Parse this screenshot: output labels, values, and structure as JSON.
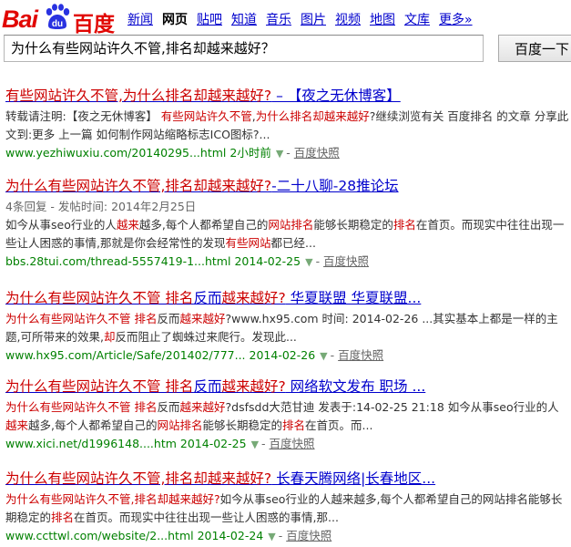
{
  "logo": {
    "part1": "Bai",
    "part2": "du",
    "part3": "百度"
  },
  "nav": [
    "新闻",
    "网页",
    "贴吧",
    "知道",
    "音乐",
    "图片",
    "视频",
    "地图",
    "文库",
    "更多»"
  ],
  "search": {
    "value": "为什么有些网站许久不管,排名却越来越好？",
    "button": "百度一下"
  },
  "results": [
    {
      "title": [
        "有些网站许久不管,为什么排名却越来越好?",
        " – 【夜之无休博客】"
      ],
      "abstract": [
        {
          "t": "转载请注明:【夜之无休博客】 "
        },
        {
          "t": "有些网站许久不管",
          "h": true
        },
        {
          "t": ","
        },
        {
          "t": "为什么排名却越来越好",
          "h": true
        },
        {
          "t": "?继续浏览有关 百度排名 的文章 分享此文到:更多 上一篇 如何制作网站缩略标志ICO图标?..."
        }
      ],
      "url": "www.yezhiwuxiu.com/20140295...html",
      "time": "2小时前",
      "cache": "百度快照"
    },
    {
      "title": [
        "为什么有些网站许久不管,排名却越来越好?",
        "-二十八聊-28推论坛"
      ],
      "subline": "4条回复 - 发帖时间: 2014年2月25日",
      "abstract": [
        {
          "t": "如今从事seo行业的人"
        },
        {
          "t": "越来",
          "h": true
        },
        {
          "t": "越多,每个人都希望自己的"
        },
        {
          "t": "网站排名",
          "h": true
        },
        {
          "t": "能够长期稳定的"
        },
        {
          "t": "排名",
          "h": true
        },
        {
          "t": "在首页。而现实中往往出现一些让人困惑的事情,那就是你会经常性的发现"
        },
        {
          "t": "有些网站",
          "h": true
        },
        {
          "t": "都已经..."
        }
      ],
      "url": "bbs.28tui.com/thread-5557419-1...html",
      "time": "2014-02-25",
      "cache": "百度快照"
    },
    {
      "title": [
        "为什么有些网站许久不管 排名",
        "反而",
        "越来越好?",
        " 华夏联盟 华夏联盟..."
      ],
      "abstract": [
        {
          "t": "为什么有些网站许久不管 排名",
          "h": true
        },
        {
          "t": "反而"
        },
        {
          "t": "越来越好",
          "h": true
        },
        {
          "t": "?www.hx95.com 时间: 2014-02-26 ...其实基本上都是一样的主题,可所带来的效果,"
        },
        {
          "t": "却",
          "h": true
        },
        {
          "t": "反而阻止了蜘蛛过来爬行。发现此..."
        }
      ],
      "url": "www.hx95.com/Article/Safe/201402/777...",
      "time": "2014-02-26",
      "cache": "百度快照"
    },
    {
      "title": [
        "为什么有些网站许久不管 排名",
        "反而",
        "越来越好?",
        " 网络软文发布 职场 ..."
      ],
      "abstract": [
        {
          "t": "为什么有些网站许久不管 排名",
          "h": true
        },
        {
          "t": "反而"
        },
        {
          "t": "越来越好",
          "h": true
        },
        {
          "t": "?dsfsdd大范甘迪 发表于:14-02-25 21:18 如今从事seo行业的人"
        },
        {
          "t": "越来",
          "h": true
        },
        {
          "t": "越多,每个人都希望自己的"
        },
        {
          "t": "网站排名",
          "h": true
        },
        {
          "t": "能够长期稳定的"
        },
        {
          "t": "排名",
          "h": true
        },
        {
          "t": "在首页。而..."
        }
      ],
      "url": "www.xici.net/d1996148....htm",
      "time": "2014-02-25",
      "cache": "百度快照"
    },
    {
      "title": [
        "为什么有些网站许久不管,排名却越来越好?",
        " 长春天腾网络|长春地区..."
      ],
      "abstract": [
        {
          "t": "为什么有些网站许久不管,排名却越来越好?",
          "h": true
        },
        {
          "t": "如今从事seo行业的人越来越多,每个人都希望自己的网站排名能够长期稳定的"
        },
        {
          "t": "排名",
          "h": true
        },
        {
          "t": "在首页。而现实中往往出现一些让人困惑的事情,那..."
        }
      ],
      "url": "www.ccttwl.com/website/2...html",
      "time": "2014-02-24",
      "cache": "百度快照"
    }
  ]
}
